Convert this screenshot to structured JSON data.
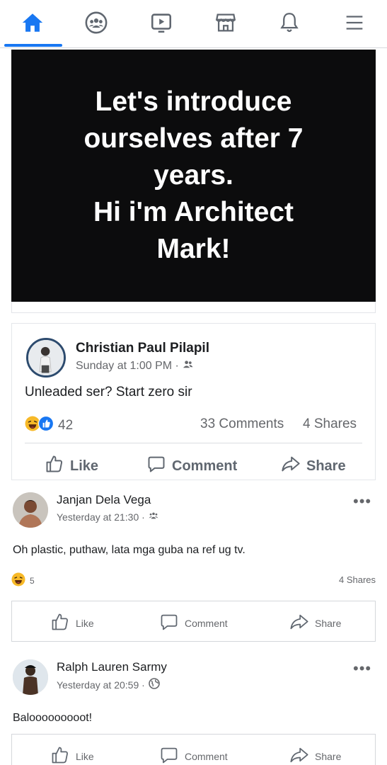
{
  "nav": {
    "items": [
      {
        "icon": "home-icon",
        "active": true
      },
      {
        "icon": "groups-icon",
        "active": false
      },
      {
        "icon": "watch-icon",
        "active": false
      },
      {
        "icon": "marketplace-icon",
        "active": false
      },
      {
        "icon": "notifications-bell-icon",
        "active": false
      },
      {
        "icon": "menu-icon",
        "active": false
      }
    ],
    "accent": "#1877f2"
  },
  "image_post": {
    "text_lines": [
      "Let's introduce",
      "ourselves after 7",
      "years.",
      "Hi i'm Architect",
      "Mark!"
    ]
  },
  "shared_post": {
    "author": "Christian Paul Pilapil",
    "time": "Sunday at 1:00 PM ·",
    "text": "Unleaded ser? Start zero sir",
    "reaction_count": "42",
    "comments": "33 Comments",
    "shares": "4 Shares",
    "actions": {
      "like": "Like",
      "comment": "Comment",
      "share": "Share"
    }
  },
  "posts": [
    {
      "author": "Janjan Dela Vega",
      "time": "Yesterday at 21:30 ·",
      "text": "Oh plastic, puthaw, lata mga guba na ref ug tv.",
      "reaction_count": "5",
      "shares": "4 Shares",
      "actions": {
        "like": "Like",
        "comment": "Comment",
        "share": "Share"
      }
    },
    {
      "author": "Ralph Lauren Sarmy",
      "time": "Yesterday at 20:59 ·",
      "text": "Balooooooooot!",
      "actions": {
        "like": "Like",
        "comment": "Comment",
        "share": "Share"
      }
    }
  ],
  "more_symbol": "•••"
}
